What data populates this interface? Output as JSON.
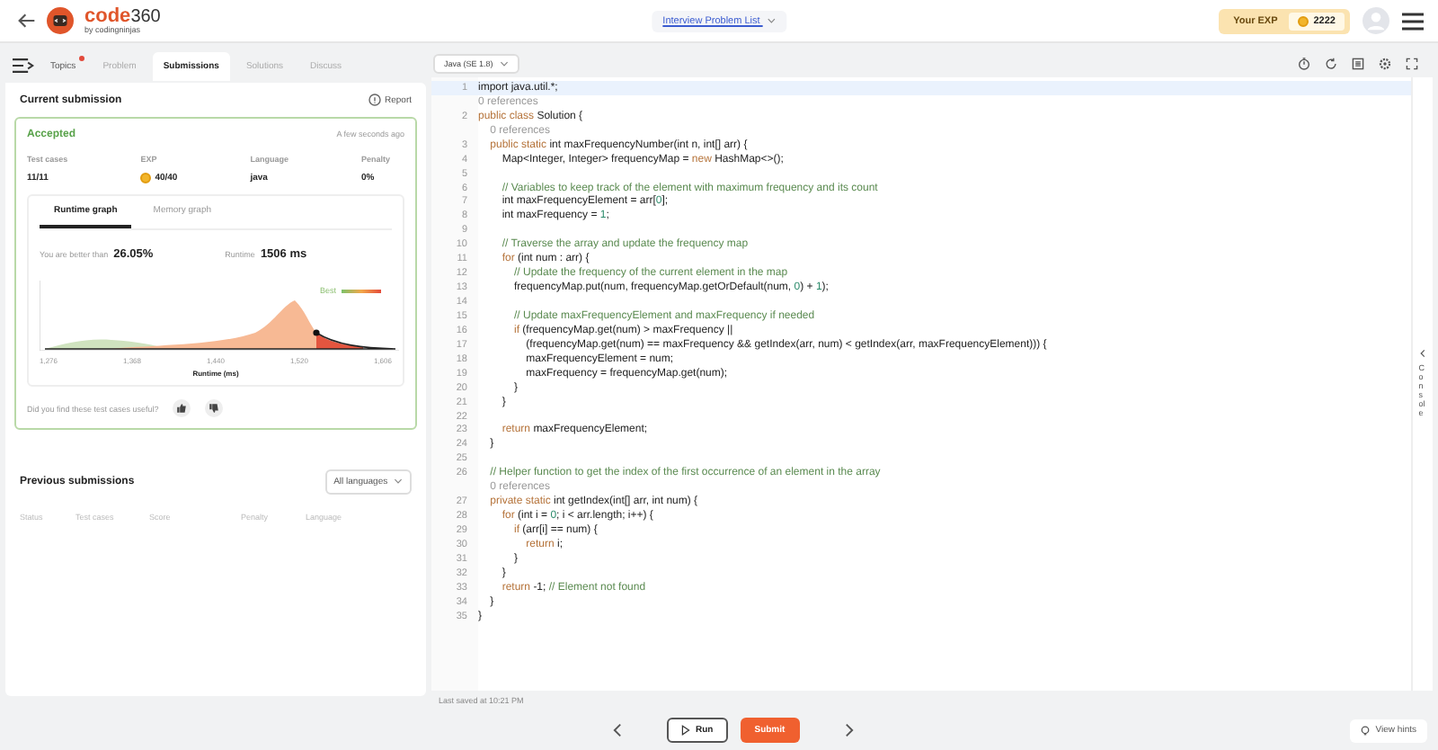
{
  "header": {
    "logo_word": "code",
    "logo_num": "360",
    "logo_sub": "by codingninjas",
    "problem_list": "Interview Problem List",
    "exp_label": "Your EXP",
    "exp_value": "2222"
  },
  "left_tabs": [
    {
      "label": "Topics",
      "selected": false,
      "notification": true
    },
    {
      "label": "Problem",
      "selected": false,
      "notification": false
    },
    {
      "label": "Submissions",
      "selected": true,
      "notification": false
    },
    {
      "label": "Solutions",
      "selected": false,
      "notification": false
    },
    {
      "label": "Discuss",
      "selected": false,
      "notification": false
    }
  ],
  "current_submission": {
    "title": "Current submission",
    "report": "Report",
    "status": "Accepted",
    "time": "A few seconds ago",
    "stats": [
      {
        "label": "Test cases",
        "value": "11/11",
        "kind": "text"
      },
      {
        "label": "EXP",
        "value": "40/40",
        "kind": "coin"
      },
      {
        "label": "Language",
        "value": "java",
        "kind": "text"
      },
      {
        "label": "Penalty",
        "value": "0%",
        "kind": "text"
      }
    ],
    "graph_tabs": [
      {
        "label": "Runtime graph",
        "selected": true
      },
      {
        "label": "Memory graph",
        "selected": false
      }
    ],
    "better_label": "You are better than",
    "better_value": "26.05%",
    "runtime_label": "Runtime",
    "runtime_value": "1506 ms",
    "legend": "Best",
    "x_ticks": [
      "1,276",
      "1,368",
      "1,440",
      "1,520",
      "1,606"
    ],
    "xlabel": "Runtime (ms)",
    "feedback": "Did you find these test cases useful?"
  },
  "previous_submissions": {
    "title": "Previous submissions",
    "filter": "All languages",
    "columns": [
      "Status",
      "Test cases",
      "Score",
      "Penalty",
      "Language"
    ]
  },
  "editor": {
    "language": "Java (SE 1.8)",
    "console": "Console",
    "last_saved": "Last saved at 10:21 PM",
    "lines": [
      {
        "kind": "code",
        "number": "1",
        "active": true,
        "segments": [
          {
            "kind": "plain",
            "text": "import java.util.*;"
          }
        ]
      },
      {
        "kind": "refs",
        "active": false,
        "segments": [
          {
            "kind": "hint",
            "text": "0 references"
          }
        ]
      },
      {
        "kind": "code",
        "number": "2",
        "active": false,
        "segments": [
          {
            "kind": "keyword",
            "text": "public class "
          },
          {
            "kind": "plain",
            "text": "Solution {"
          }
        ]
      },
      {
        "kind": "refs",
        "active": false,
        "segments": [
          {
            "kind": "hint",
            "text": "    0 references"
          }
        ]
      },
      {
        "kind": "code",
        "number": "3",
        "active": false,
        "segments": [
          {
            "kind": "keyword",
            "text": "    public static "
          },
          {
            "kind": "plain",
            "text": "int maxFrequencyNumber(int n, int[] arr) {"
          }
        ]
      },
      {
        "kind": "code",
        "number": "4",
        "active": false,
        "segments": [
          {
            "kind": "plain",
            "text": "        Map<Integer, Integer> frequencyMap = "
          },
          {
            "kind": "keyword",
            "text": "new "
          },
          {
            "kind": "plain",
            "text": "HashMap<>();"
          }
        ]
      },
      {
        "kind": "code",
        "number": "5",
        "active": false
      },
      {
        "kind": "code",
        "number": "6",
        "active": false,
        "segments": [
          {
            "kind": "comment",
            "text": "        // Variables to keep track of the element with maximum frequency and its count"
          }
        ]
      },
      {
        "kind": "code",
        "number": "7",
        "active": false,
        "segments": [
          {
            "kind": "plain",
            "text": "        int maxFrequencyElement = arr["
          },
          {
            "kind": "number",
            "text": "0"
          },
          {
            "kind": "plain",
            "text": "];"
          }
        ]
      },
      {
        "kind": "code",
        "number": "8",
        "active": false,
        "segments": [
          {
            "kind": "plain",
            "text": "        int maxFrequency = "
          },
          {
            "kind": "number",
            "text": "1"
          },
          {
            "kind": "plain",
            "text": ";"
          }
        ]
      },
      {
        "kind": "code",
        "number": "9",
        "active": false
      },
      {
        "kind": "code",
        "number": "10",
        "active": false,
        "segments": [
          {
            "kind": "comment",
            "text": "        // Traverse the array and update the frequency map"
          }
        ]
      },
      {
        "kind": "code",
        "number": "11",
        "active": false,
        "segments": [
          {
            "kind": "keyword",
            "text": "        for "
          },
          {
            "kind": "plain",
            "text": "(int num : arr) {"
          }
        ]
      },
      {
        "kind": "code",
        "number": "12",
        "active": false,
        "segments": [
          {
            "kind": "comment",
            "text": "            // Update the frequency of the current element in the map"
          }
        ]
      },
      {
        "kind": "code",
        "number": "13",
        "active": false,
        "segments": [
          {
            "kind": "plain",
            "text": "            frequencyMap.put(num, frequencyMap.getOrDefault(num, "
          },
          {
            "kind": "number",
            "text": "0"
          },
          {
            "kind": "plain",
            "text": ") + "
          },
          {
            "kind": "number",
            "text": "1"
          },
          {
            "kind": "plain",
            "text": ");"
          }
        ]
      },
      {
        "kind": "code",
        "number": "14",
        "active": false
      },
      {
        "kind": "code",
        "number": "15",
        "active": false,
        "segments": [
          {
            "kind": "comment",
            "text": "            // Update maxFrequencyElement and maxFrequency if needed"
          }
        ]
      },
      {
        "kind": "code",
        "number": "16",
        "active": false,
        "segments": [
          {
            "kind": "keyword",
            "text": "            if "
          },
          {
            "kind": "plain",
            "text": "(frequencyMap.get(num) > maxFrequency ||"
          }
        ]
      },
      {
        "kind": "code",
        "number": "17",
        "active": false,
        "segments": [
          {
            "kind": "plain",
            "text": "                (frequencyMap.get(num) == maxFrequency && getIndex(arr, num) < getIndex(arr, maxFrequencyElement))) {"
          }
        ]
      },
      {
        "kind": "code",
        "number": "18",
        "active": false,
        "segments": [
          {
            "kind": "plain",
            "text": "                maxFrequencyElement = num;"
          }
        ]
      },
      {
        "kind": "code",
        "number": "19",
        "active": false,
        "segments": [
          {
            "kind": "plain",
            "text": "                maxFrequency = frequencyMap.get(num);"
          }
        ]
      },
      {
        "kind": "code",
        "number": "20",
        "active": false,
        "segments": [
          {
            "kind": "plain",
            "text": "            }"
          }
        ]
      },
      {
        "kind": "code",
        "number": "21",
        "active": false,
        "segments": [
          {
            "kind": "plain",
            "text": "        }"
          }
        ]
      },
      {
        "kind": "code",
        "number": "22",
        "active": false
      },
      {
        "kind": "code",
        "number": "23",
        "active": false,
        "segments": [
          {
            "kind": "keyword",
            "text": "        return "
          },
          {
            "kind": "plain",
            "text": "maxFrequencyElement;"
          }
        ]
      },
      {
        "kind": "code",
        "number": "24",
        "active": false,
        "segments": [
          {
            "kind": "plain",
            "text": "    }"
          }
        ]
      },
      {
        "kind": "code",
        "number": "25",
        "active": false
      },
      {
        "kind": "code",
        "number": "26",
        "active": false,
        "segments": [
          {
            "kind": "comment",
            "text": "    // Helper function to get the index of the first occurrence of an element in the array"
          }
        ]
      },
      {
        "kind": "refs",
        "active": false,
        "segments": [
          {
            "kind": "hint",
            "text": "    0 references"
          }
        ]
      },
      {
        "kind": "code",
        "number": "27",
        "active": false,
        "segments": [
          {
            "kind": "keyword",
            "text": "    private static "
          },
          {
            "kind": "plain",
            "text": "int getIndex(int[] arr, int num) {"
          }
        ]
      },
      {
        "kind": "code",
        "number": "28",
        "active": false,
        "segments": [
          {
            "kind": "keyword",
            "text": "        for "
          },
          {
            "kind": "plain",
            "text": "(int i = "
          },
          {
            "kind": "number",
            "text": "0"
          },
          {
            "kind": "plain",
            "text": "; i < arr.length; i++) {"
          }
        ]
      },
      {
        "kind": "code",
        "number": "29",
        "active": false,
        "segments": [
          {
            "kind": "keyword",
            "text": "            if "
          },
          {
            "kind": "plain",
            "text": "(arr[i] == num) {"
          }
        ]
      },
      {
        "kind": "code",
        "number": "30",
        "active": false,
        "segments": [
          {
            "kind": "keyword",
            "text": "                return "
          },
          {
            "kind": "plain",
            "text": "i;"
          }
        ]
      },
      {
        "kind": "code",
        "number": "31",
        "active": false,
        "segments": [
          {
            "kind": "plain",
            "text": "            }"
          }
        ]
      },
      {
        "kind": "code",
        "number": "32",
        "active": false,
        "segments": [
          {
            "kind": "plain",
            "text": "        }"
          }
        ]
      },
      {
        "kind": "code",
        "number": "33",
        "active": false,
        "segments": [
          {
            "kind": "keyword",
            "text": "        return "
          },
          {
            "kind": "plain",
            "text": "-1; "
          },
          {
            "kind": "comment",
            "text": "// Element not found"
          }
        ]
      },
      {
        "kind": "code",
        "number": "34",
        "active": false,
        "segments": [
          {
            "kind": "plain",
            "text": "    }"
          }
        ]
      },
      {
        "kind": "code",
        "number": "35",
        "active": false,
        "segments": [
          {
            "kind": "plain",
            "text": "}"
          }
        ]
      }
    ]
  },
  "bottom": {
    "run": "Run",
    "submit": "Submit",
    "hints": "View hints"
  }
}
